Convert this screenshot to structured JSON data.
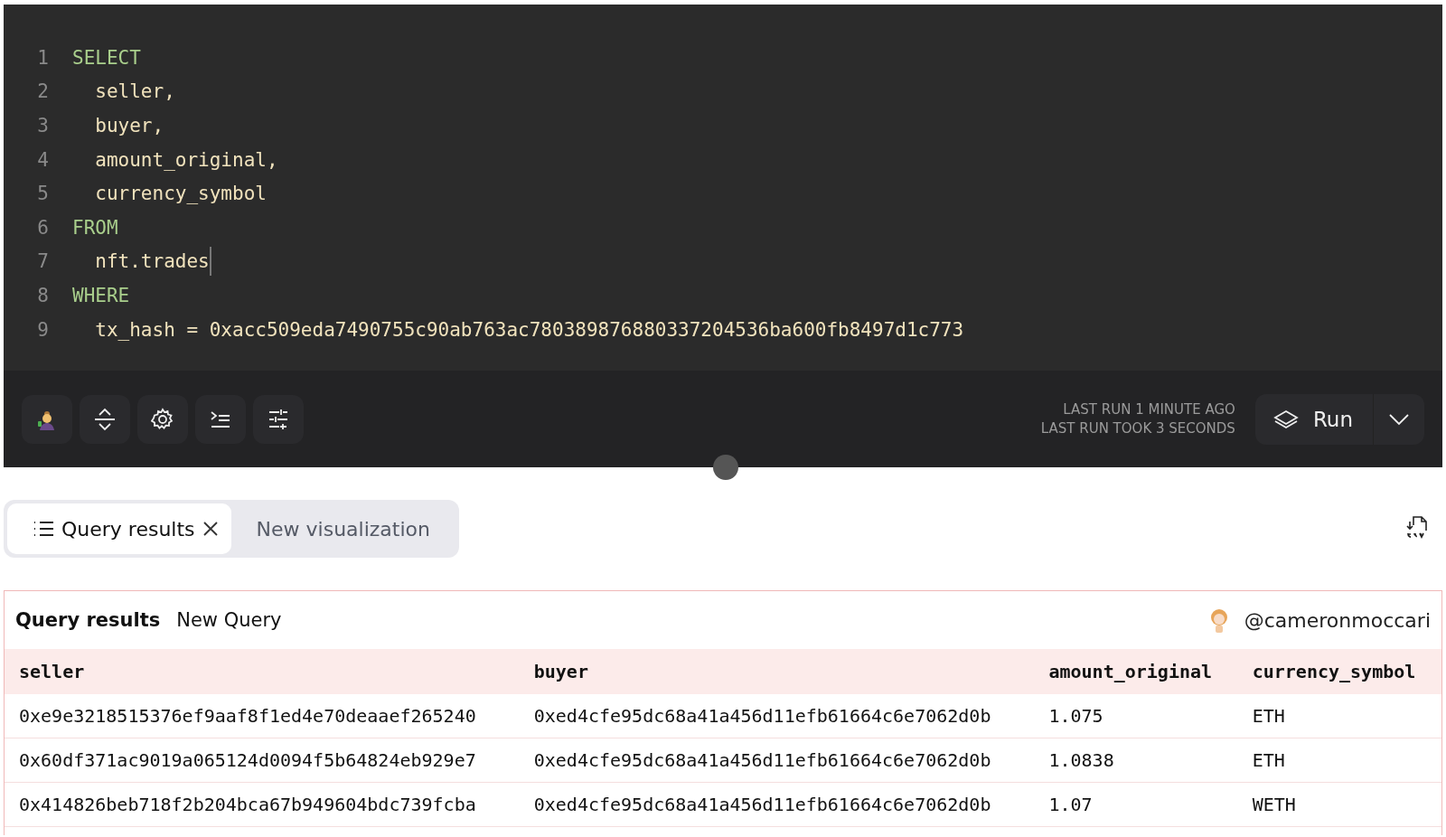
{
  "editor": {
    "lines": [
      {
        "number": "1",
        "kind": "keyword",
        "text": "SELECT",
        "cursor": false
      },
      {
        "number": "2",
        "kind": "plain",
        "text": "  seller,",
        "cursor": false
      },
      {
        "number": "3",
        "kind": "plain",
        "text": "  buyer,",
        "cursor": false
      },
      {
        "number": "4",
        "kind": "plain",
        "text": "  amount_original,",
        "cursor": false
      },
      {
        "number": "5",
        "kind": "plain",
        "text": "  currency_symbol",
        "cursor": false
      },
      {
        "number": "6",
        "kind": "keyword",
        "text": "FROM",
        "cursor": false
      },
      {
        "number": "7",
        "kind": "plain",
        "text": "  nft.trades",
        "cursor": true
      },
      {
        "number": "8",
        "kind": "keyword",
        "text": "WHERE",
        "cursor": false
      },
      {
        "number": "9",
        "kind": "plain",
        "text": "  tx_hash = 0xacc509eda7490755c90ab763ac780389876880337204536ba600fb8497d1c773",
        "cursor": false
      }
    ]
  },
  "toolbar": {
    "tools": [
      {
        "kind": "avatar"
      },
      {
        "kind": "expand"
      },
      {
        "kind": "settings"
      },
      {
        "kind": "indent"
      },
      {
        "kind": "sliders"
      }
    ],
    "last_run": "LAST RUN 1 MINUTE AGO",
    "last_run_duration": "LAST RUN TOOK 3 SECONDS",
    "run_button": "Run"
  },
  "tabs": [
    {
      "label": "Query results",
      "selected": true,
      "closable": true
    },
    {
      "label": "New visualization",
      "selected": false,
      "closable": false
    }
  ],
  "results": {
    "title": "Query results",
    "query_name": "New Query",
    "author": "@cameronmoccari",
    "columns": [
      "seller",
      "buyer",
      "amount_original",
      "currency_symbol"
    ],
    "rows": [
      [
        "0xe9e3218515376ef9aaf8f1ed4e70deaaef265240",
        "0xed4cfe95dc68a41a456d11efb61664c6e7062d0b",
        "1.075",
        "ETH"
      ],
      [
        "0x60df371ac9019a065124d0094f5b64824eb929e7",
        "0xed4cfe95dc68a41a456d11efb61664c6e7062d0b",
        "1.0838",
        "ETH"
      ],
      [
        "0x414826beb718f2b204bca67b949604bdc739fcba",
        "0xed4cfe95dc68a41a456d11efb61664c6e7062d0b",
        "1.07",
        "WETH"
      ]
    ]
  }
}
